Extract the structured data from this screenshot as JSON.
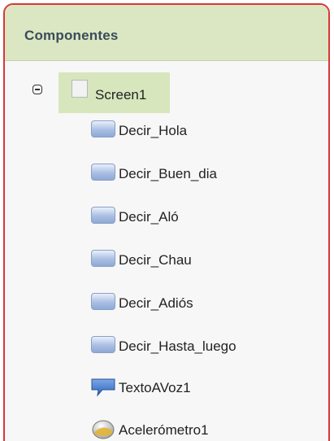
{
  "panel": {
    "title": "Componentes"
  },
  "tree": {
    "root": {
      "label": "Screen1",
      "icon": "screen-icon",
      "expanded": true
    },
    "children": [
      {
        "label": "Decir_Hola",
        "icon": "button-icon"
      },
      {
        "label": "Decir_Buen_dia",
        "icon": "button-icon"
      },
      {
        "label": "Decir_Aló",
        "icon": "button-icon"
      },
      {
        "label": "Decir_Chau",
        "icon": "button-icon"
      },
      {
        "label": "Decir_Adiós",
        "icon": "button-icon"
      },
      {
        "label": "Decir_Hasta_luego",
        "icon": "button-icon"
      },
      {
        "label": "TextoAVoz1",
        "icon": "text-to-speech-icon"
      },
      {
        "label": "Acelerómetro1",
        "icon": "accelerometer-icon"
      }
    ]
  },
  "colors": {
    "border": "#d9363a",
    "header_bg": "#dbe7c2",
    "selected_bg": "#d7e6bc"
  }
}
